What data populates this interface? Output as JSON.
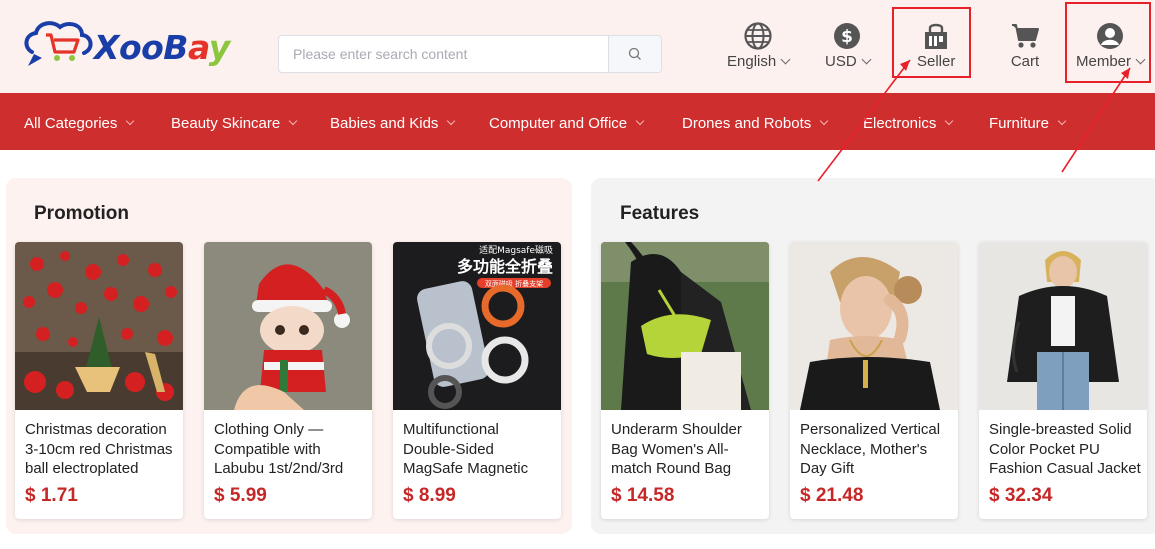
{
  "brand": {
    "name_parts": [
      "X",
      "oo",
      "B",
      "a",
      "y"
    ],
    "colors": [
      "#1a3ea8",
      "#1a3ea8",
      "#1a3ea8",
      "#e5332a",
      "#8cc63f"
    ]
  },
  "search": {
    "placeholder": "Please enter search content",
    "value": "",
    "icon": "search-icon"
  },
  "header": {
    "language": {
      "label": "English",
      "icon": "globe-icon"
    },
    "currency": {
      "label": "USD",
      "icon": "dollar-icon"
    },
    "seller": {
      "label": "Seller",
      "icon": "shop-icon"
    },
    "cart": {
      "label": "Cart",
      "icon": "cart-icon"
    },
    "member": {
      "label": "Member",
      "icon": "user-icon"
    }
  },
  "nav": {
    "items": [
      {
        "label": "All Categories"
      },
      {
        "label": "Beauty Skincare"
      },
      {
        "label": "Babies and Kids"
      },
      {
        "label": "Computer and Office"
      },
      {
        "label": "Drones and Robots"
      },
      {
        "label": "Electronics"
      },
      {
        "label": "Furniture"
      }
    ]
  },
  "promotion": {
    "title": "Promotion",
    "products": [
      {
        "title": "Christmas decoration 3-10cm red Christmas ball electroplated",
        "price": "$ 1.71"
      },
      {
        "title": "Clothing Only — Compatible with Labubu 1st/2nd/3rd",
        "price": "$ 5.99"
      },
      {
        "title": "Multifunctional Double-Sided MagSafe Magnetic",
        "price": "$ 8.99",
        "image_text": {
          "top": "适配Magsafe磁吸",
          "main": "多功能全折叠",
          "sub": "双面磁吸 折叠支架"
        }
      }
    ]
  },
  "features": {
    "title": "Features",
    "products": [
      {
        "title": "Underarm Shoulder Bag Women's All-match Round Bag",
        "price": "$ 14.58"
      },
      {
        "title": "Personalized Vertical Necklace, Mother's Day Gift",
        "price": "$ 21.48"
      },
      {
        "title": "Single-breasted Solid Color Pocket PU Fashion Casual Jacket",
        "price": "$ 32.34"
      }
    ]
  },
  "colors": {
    "nav_bg": "#cf2e2e",
    "header_bg": "#fdf1ef",
    "price": "#c62828",
    "highlight": "#e8202a"
  }
}
